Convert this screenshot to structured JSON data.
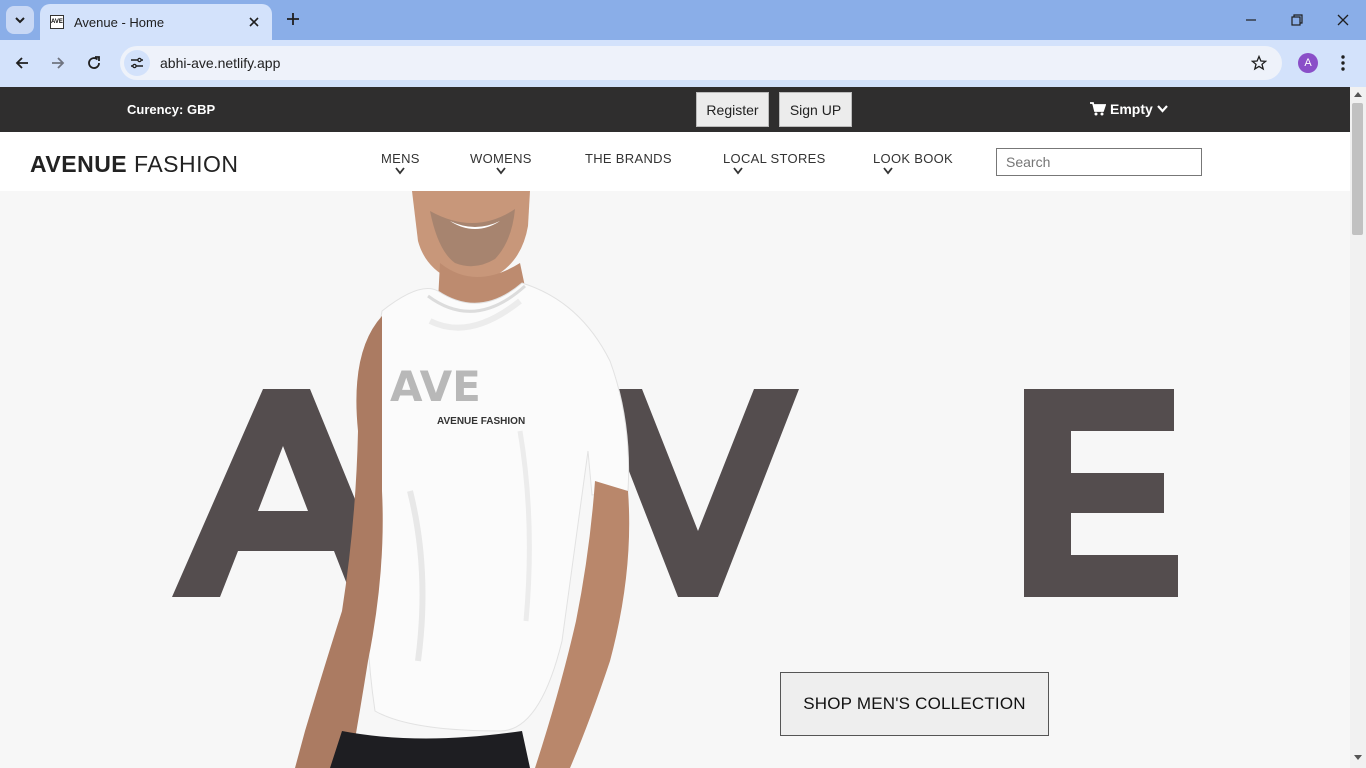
{
  "browser": {
    "tab_title": "Avenue - Home",
    "favicon_text": "AVE",
    "url": "abhi-ave.netlify.app",
    "profile_initial": "A"
  },
  "topbar": {
    "currency_label": "Curency: GBP",
    "register_label": "Register",
    "signup_label": "Sign UP",
    "cart_label": "Empty"
  },
  "header": {
    "logo_bold": "AVENUE",
    "logo_light": "FASHION",
    "nav": [
      "MENS",
      "WOMENS",
      "THE BRANDS",
      "LOCAL STORES",
      "LOOK BOOK"
    ],
    "search_placeholder": "Search"
  },
  "hero": {
    "letters": [
      "A",
      "V",
      "E"
    ],
    "shirt_text": "AVE",
    "shirt_caption": "AVENUE FASHION",
    "cta_label": "SHOP MEN'S COLLECTION"
  },
  "colors": {
    "topbar_bg": "#2f2e2e",
    "hero_letter": "#544d4e",
    "tabstrip": "#8aaee8",
    "toolbar": "#d3e2fb"
  }
}
